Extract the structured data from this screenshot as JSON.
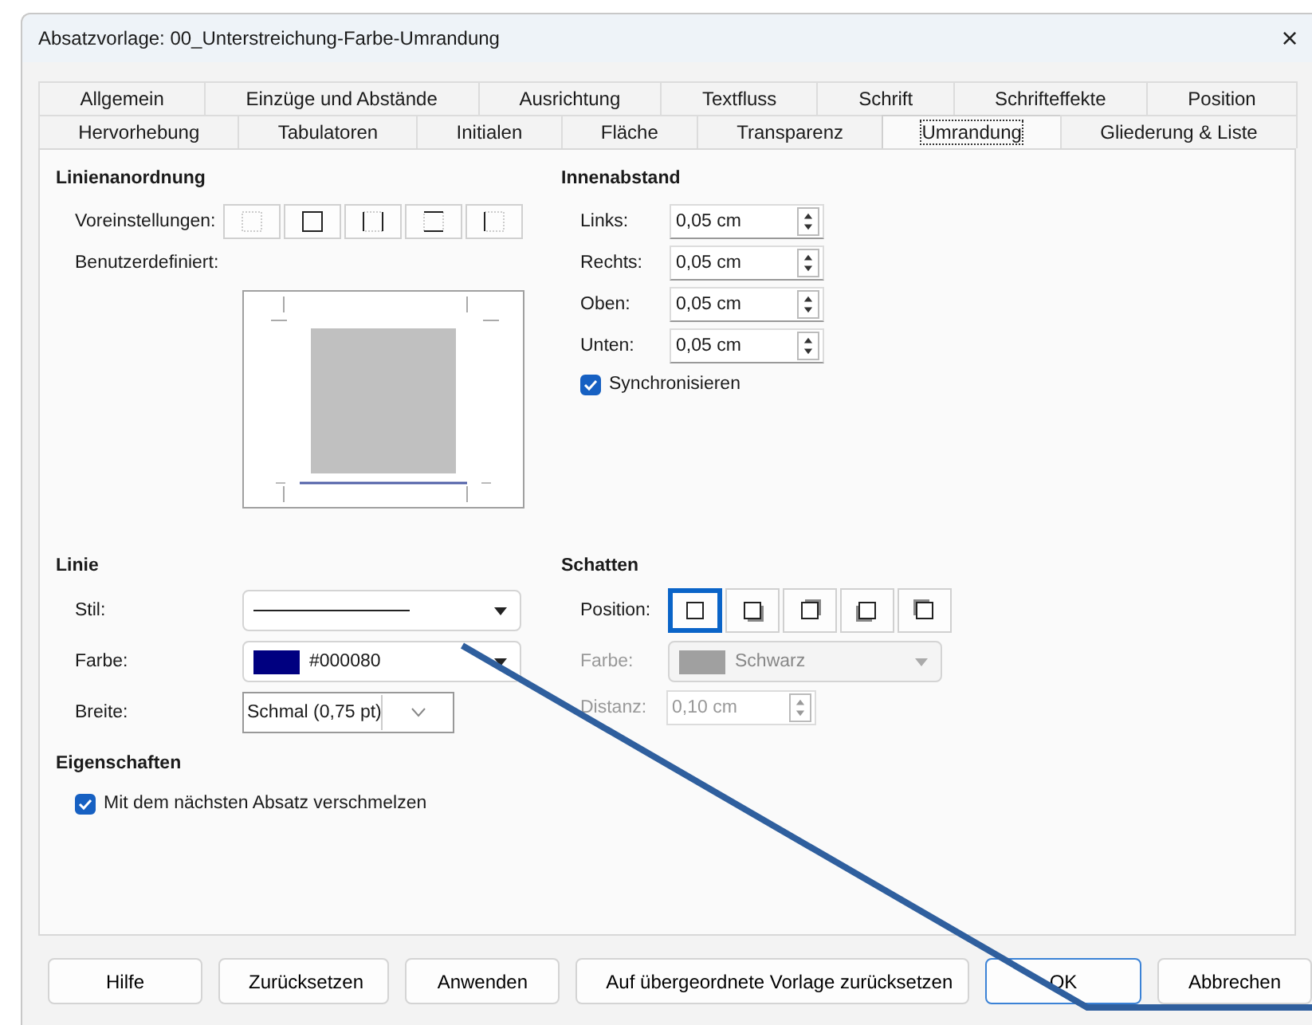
{
  "window": {
    "title": "Absatzvorlage: 00_Unterstreichung-Farbe-Umrandung",
    "close": "×"
  },
  "tab_rows": [
    {
      "tabs": [
        {
          "label": "Allgemein",
          "selected": false
        },
        {
          "label": "Einzüge und Abstände",
          "selected": false
        },
        {
          "label": "Ausrichtung",
          "selected": false
        },
        {
          "label": "Textfluss",
          "selected": false
        },
        {
          "label": "Schrift",
          "selected": false
        },
        {
          "label": "Schrifteffekte",
          "selected": false
        },
        {
          "label": "Position",
          "selected": false
        }
      ]
    },
    {
      "tabs": [
        {
          "label": "Hervorhebung",
          "selected": false
        },
        {
          "label": "Tabulatoren",
          "selected": false
        },
        {
          "label": "Initialen",
          "selected": false
        },
        {
          "label": "Fläche",
          "selected": false
        },
        {
          "label": "Transparenz",
          "selected": false
        },
        {
          "label": "Umrandung",
          "selected": true
        },
        {
          "label": "Gliederung & Liste",
          "selected": false
        }
      ]
    }
  ],
  "line_arrangement": {
    "heading": "Linienanordnung",
    "presets_label": "Voreinstellungen:",
    "presets": [
      {
        "kind": "none",
        "selected": false
      },
      {
        "kind": "box",
        "selected": false
      },
      {
        "kind": "sides",
        "selected": false
      },
      {
        "kind": "topbottom",
        "selected": false
      },
      {
        "kind": "left",
        "selected": false
      }
    ],
    "user_defined_label": "Benutzerdefiniert:"
  },
  "padding": {
    "heading": "Innenabstand",
    "fields": [
      {
        "label": "Links:",
        "value": "0,05 cm"
      },
      {
        "label": "Rechts:",
        "value": "0,05 cm"
      },
      {
        "label": "Oben:",
        "value": "0,05 cm"
      },
      {
        "label": "Unten:",
        "value": "0,05 cm"
      }
    ],
    "sync": {
      "label": "Synchronisieren",
      "checked": true
    }
  },
  "line": {
    "heading": "Linie",
    "style": {
      "label": "Stil:"
    },
    "color": {
      "label": "Farbe:",
      "value": "#000080",
      "color": "#000080"
    },
    "width": {
      "label": "Breite:",
      "value": "Schmal (0,75 pt)"
    }
  },
  "shadow": {
    "heading": "Schatten",
    "position_label": "Position:",
    "positions": [
      {
        "kind": "none",
        "selected": true
      },
      {
        "kind": "bottomright",
        "selected": false
      },
      {
        "kind": "topright",
        "selected": false
      },
      {
        "kind": "bottomleft",
        "selected": false
      },
      {
        "kind": "topleft",
        "selected": false
      }
    ],
    "color": {
      "label": "Farbe:",
      "value": "Schwarz",
      "color": "#a0a0a0",
      "disabled": true
    },
    "distance": {
      "label": "Distanz:",
      "value": "0,10 cm",
      "disabled": true
    }
  },
  "properties": {
    "heading": "Eigenschaften",
    "merge": {
      "label": "Mit dem nächsten Absatz verschmelzen",
      "checked": true
    }
  },
  "buttons": [
    {
      "label": "Hilfe",
      "default": false
    },
    {
      "label": "Zurücksetzen",
      "default": false
    },
    {
      "label": "Anwenden",
      "default": false
    },
    {
      "label": "Auf übergeordnete Vorlage zurücksetzen",
      "default": false
    },
    {
      "label": "OK",
      "default": true
    },
    {
      "label": "Abbrechen",
      "default": false
    }
  ]
}
